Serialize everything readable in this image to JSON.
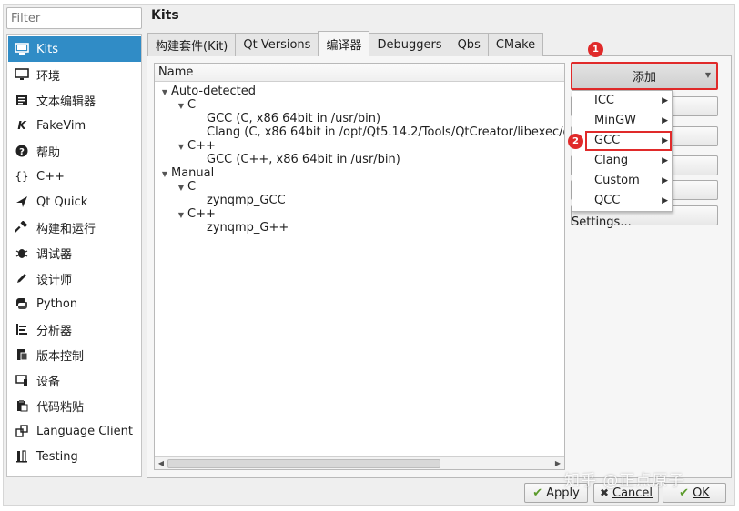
{
  "filter": {
    "placeholder": "Filter"
  },
  "sidebar": {
    "items": [
      {
        "label": "Kits",
        "icon": "monitor-icon"
      },
      {
        "label": "环境",
        "icon": "desktop-icon"
      },
      {
        "label": "文本编辑器",
        "icon": "text-editor-icon"
      },
      {
        "label": "FakeVim",
        "icon": "fakevim-icon"
      },
      {
        "label": "帮助",
        "icon": "help-icon"
      },
      {
        "label": "C++",
        "icon": "braces-icon"
      },
      {
        "label": "Qt Quick",
        "icon": "qtquick-icon"
      },
      {
        "label": "构建和运行",
        "icon": "hammer-icon"
      },
      {
        "label": "调试器",
        "icon": "bug-icon"
      },
      {
        "label": "设计师",
        "icon": "pencil-icon"
      },
      {
        "label": "Python",
        "icon": "python-icon"
      },
      {
        "label": "分析器",
        "icon": "analyzer-icon"
      },
      {
        "label": "版本控制",
        "icon": "version-control-icon"
      },
      {
        "label": "设备",
        "icon": "device-icon"
      },
      {
        "label": "代码粘贴",
        "icon": "paste-icon"
      },
      {
        "label": "Language Client",
        "icon": "language-client-icon"
      },
      {
        "label": "Testing",
        "icon": "testing-icon"
      }
    ],
    "active_index": 0
  },
  "page_title": "Kits",
  "tabs": [
    {
      "label": "构建套件(Kit)"
    },
    {
      "label": "Qt Versions"
    },
    {
      "label": "编译器"
    },
    {
      "label": "Debuggers"
    },
    {
      "label": "Qbs"
    },
    {
      "label": "CMake"
    }
  ],
  "active_tab": 2,
  "tree": {
    "header": "Name",
    "nodes": [
      {
        "label": "Auto-detected"
      },
      {
        "label": "C"
      },
      {
        "label": "GCC (C, x86 64bit in /usr/bin)"
      },
      {
        "label": "Clang (C, x86 64bit in /opt/Qt5.14.2/Tools/QtCreator/libexec/qtcre"
      },
      {
        "label": "C++"
      },
      {
        "label": "GCC (C++, x86 64bit in /usr/bin)"
      },
      {
        "label": "Manual"
      },
      {
        "label": "C"
      },
      {
        "label": "zynqmp_GCC"
      },
      {
        "label": "C++"
      },
      {
        "label": "zynqmp_G++"
      }
    ]
  },
  "buttons": {
    "add": "添加",
    "remove_partial": "l",
    "auto_detection_settings": "Auto-detection Settings..."
  },
  "add_menu": {
    "items": [
      {
        "label": "ICC"
      },
      {
        "label": "MinGW"
      },
      {
        "label": "GCC"
      },
      {
        "label": "Clang"
      },
      {
        "label": "Custom"
      },
      {
        "label": "QCC"
      }
    ],
    "highlighted": "GCC"
  },
  "badges": {
    "first": "1",
    "second": "2"
  },
  "footer": {
    "apply": "Apply",
    "cancel": "Cancel",
    "ok": "OK"
  },
  "watermark": "知乎 @正点原子",
  "colors": {
    "accent": "#308cc6",
    "highlight_red": "#e02a2a"
  }
}
